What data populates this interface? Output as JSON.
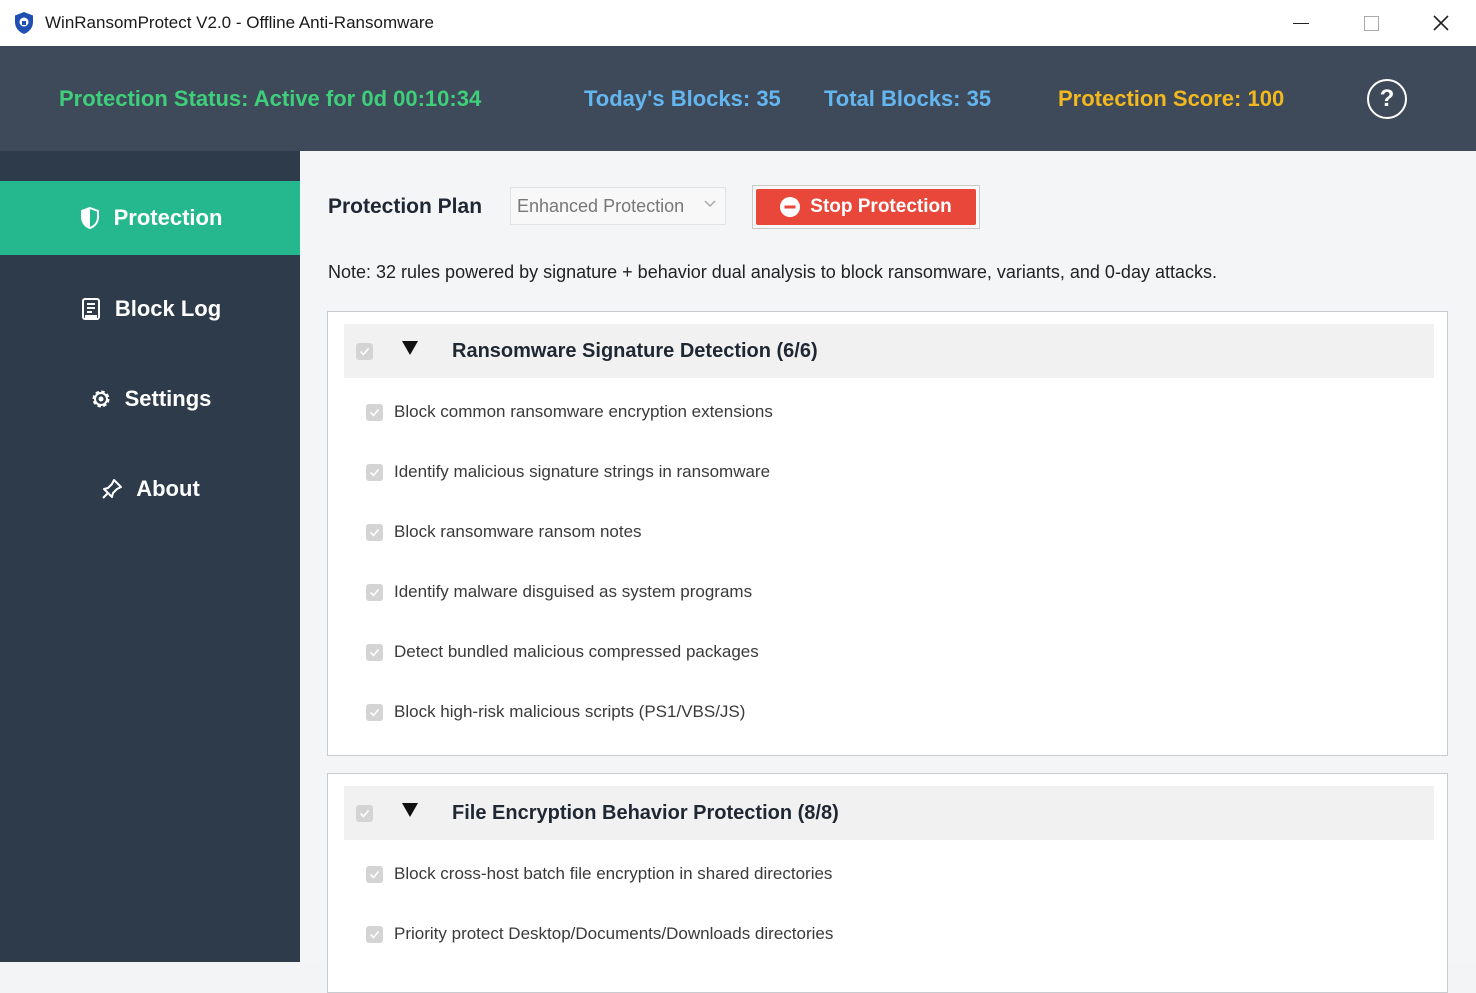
{
  "window": {
    "title": "WinRansomProtect V2.0 - Offline Anti-Ransomware"
  },
  "header": {
    "status": "Protection Status: Active for 0d 00:10:34",
    "today_blocks": "Today's Blocks: 35",
    "total_blocks": "Total Blocks: 35",
    "score": "Protection Score: 100",
    "help": "?"
  },
  "sidebar": {
    "items": [
      {
        "label": "Protection",
        "icon": "shield-icon",
        "active": true
      },
      {
        "label": "Block Log",
        "icon": "log-icon",
        "active": false
      },
      {
        "label": "Settings",
        "icon": "gear-icon",
        "active": false
      },
      {
        "label": "About",
        "icon": "pin-icon",
        "active": false
      }
    ]
  },
  "main": {
    "plan_label": "Protection Plan",
    "plan_select": "Enhanced Protection",
    "stop_button": "Stop Protection",
    "note": "Note: 32 rules powered by signature + behavior dual analysis to block ransomware, variants, and 0-day attacks.",
    "groups": [
      {
        "title": "Ransomware Signature Detection (6/6)",
        "rules": [
          "Block common ransomware encryption extensions",
          "Identify malicious signature strings in ransomware",
          "Block ransomware ransom notes",
          "Identify malware disguised as system programs",
          "Detect bundled malicious compressed packages",
          "Block high-risk malicious scripts (PS1/VBS/JS)"
        ]
      },
      {
        "title": "File Encryption Behavior Protection (8/8)",
        "rules": [
          "Block cross-host batch file encryption in shared directories",
          "Priority protect Desktop/Documents/Downloads directories"
        ]
      }
    ]
  },
  "colors": {
    "header_bg": "#3e4a5a",
    "sidebar_bg": "#2d3b4b",
    "active_nav": "#25b88e",
    "status_green": "#3ecf7a",
    "blocks_blue": "#64b6f0",
    "score_yellow": "#f2b81e",
    "stop_red": "#e8473a"
  }
}
